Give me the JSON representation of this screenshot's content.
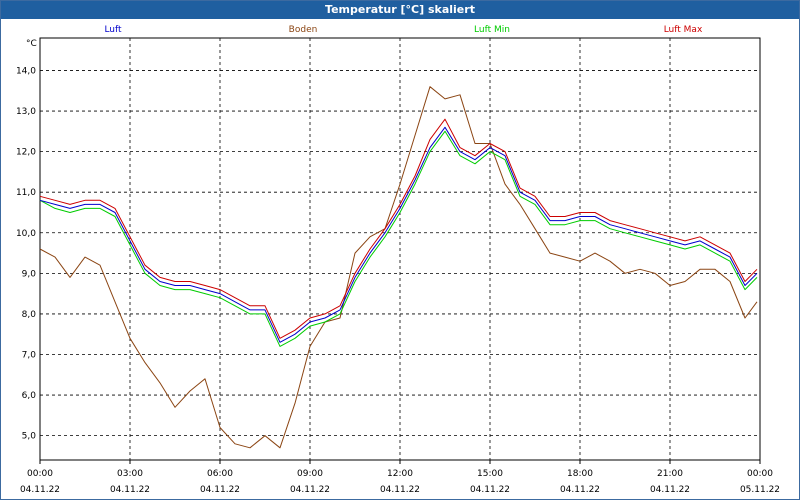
{
  "window": {
    "title": "Temperatur [°C] skaliert"
  },
  "chart_data": {
    "type": "line",
    "title": "Temperatur [°C] skaliert",
    "ylabel": "°C",
    "xlabel": "",
    "ylim": [
      4.4,
      14.8
    ],
    "xlim": [
      0,
      24
    ],
    "grid": true,
    "legend_position": "top",
    "y_ticks": [
      "5,0",
      "6,0",
      "7,0",
      "8,0",
      "9,0",
      "10,0",
      "11,0",
      "12,0",
      "13,0",
      "14,0"
    ],
    "y_tick_values": [
      5,
      6,
      7,
      8,
      9,
      10,
      11,
      12,
      13,
      14
    ],
    "x_ticks": [
      {
        "time": "00:00",
        "date": "04.11.22"
      },
      {
        "time": "03:00",
        "date": "04.11.22"
      },
      {
        "time": "06:00",
        "date": "04.11.22"
      },
      {
        "time": "09:00",
        "date": "04.11.22"
      },
      {
        "time": "12:00",
        "date": "04.11.22"
      },
      {
        "time": "15:00",
        "date": "04.11.22"
      },
      {
        "time": "18:00",
        "date": "04.11.22"
      },
      {
        "time": "21:00",
        "date": "04.11.22"
      },
      {
        "time": "00:00",
        "date": "05.11.22"
      }
    ],
    "x_tick_values": [
      0,
      3,
      6,
      9,
      12,
      15,
      18,
      21,
      24
    ],
    "x": [
      0,
      0.5,
      1,
      1.5,
      2,
      2.5,
      3,
      3.5,
      4,
      4.5,
      5,
      5.5,
      6,
      6.5,
      7,
      7.5,
      8,
      8.5,
      9,
      9.5,
      10,
      10.5,
      11,
      11.5,
      12,
      12.5,
      13,
      13.5,
      14,
      14.5,
      15,
      15.5,
      16,
      16.5,
      17,
      17.5,
      18,
      18.5,
      19,
      19.5,
      20,
      20.5,
      21,
      21.5,
      22,
      22.5,
      23,
      23.5,
      23.9
    ],
    "series": [
      {
        "name": "Luft",
        "color": "#0000cc",
        "values": [
          10.8,
          10.7,
          10.6,
          10.7,
          10.7,
          10.5,
          9.8,
          9.1,
          8.8,
          8.7,
          8.7,
          8.6,
          8.5,
          8.3,
          8.1,
          8.1,
          7.3,
          7.5,
          7.8,
          7.9,
          8.1,
          8.9,
          9.5,
          10.0,
          10.6,
          11.3,
          12.1,
          12.6,
          12.0,
          11.8,
          12.1,
          11.9,
          11.0,
          10.8,
          10.3,
          10.3,
          10.4,
          10.4,
          10.2,
          10.1,
          10.0,
          9.9,
          9.8,
          9.7,
          9.8,
          9.6,
          9.4,
          8.7,
          9.0
        ]
      },
      {
        "name": "Boden",
        "color": "#8b4513",
        "values": [
          9.6,
          9.4,
          8.9,
          9.4,
          9.2,
          8.3,
          7.4,
          6.8,
          6.3,
          5.7,
          6.1,
          6.4,
          5.2,
          4.8,
          4.7,
          5.0,
          4.7,
          5.8,
          7.2,
          7.8,
          7.9,
          9.5,
          9.9,
          10.1,
          11.2,
          12.4,
          13.6,
          13.3,
          13.4,
          12.2,
          12.2,
          11.2,
          10.7,
          10.1,
          9.5,
          9.4,
          9.3,
          9.5,
          9.3,
          9.0,
          9.1,
          9.0,
          8.7,
          8.8,
          9.1,
          9.1,
          8.8,
          7.9,
          8.3
        ]
      },
      {
        "name": "Luft Min",
        "color": "#00cc00",
        "values": [
          10.8,
          10.6,
          10.5,
          10.6,
          10.6,
          10.4,
          9.7,
          9.0,
          8.7,
          8.6,
          8.6,
          8.5,
          8.4,
          8.2,
          8.0,
          8.0,
          7.2,
          7.4,
          7.7,
          7.8,
          8.0,
          8.8,
          9.4,
          9.9,
          10.5,
          11.2,
          12.0,
          12.5,
          11.9,
          11.7,
          12.0,
          11.8,
          10.9,
          10.7,
          10.2,
          10.2,
          10.3,
          10.3,
          10.1,
          10.0,
          9.9,
          9.8,
          9.7,
          9.6,
          9.7,
          9.5,
          9.3,
          8.6,
          8.9
        ]
      },
      {
        "name": "Luft Max",
        "color": "#cc0000",
        "values": [
          10.9,
          10.8,
          10.7,
          10.8,
          10.8,
          10.6,
          9.9,
          9.2,
          8.9,
          8.8,
          8.8,
          8.7,
          8.6,
          8.4,
          8.2,
          8.2,
          7.4,
          7.6,
          7.9,
          8.0,
          8.2,
          9.0,
          9.6,
          10.1,
          10.7,
          11.4,
          12.3,
          12.8,
          12.1,
          11.9,
          12.2,
          12.0,
          11.1,
          10.9,
          10.4,
          10.4,
          10.5,
          10.5,
          10.3,
          10.2,
          10.1,
          10.0,
          9.9,
          9.8,
          9.9,
          9.7,
          9.5,
          8.8,
          9.1
        ]
      }
    ]
  }
}
